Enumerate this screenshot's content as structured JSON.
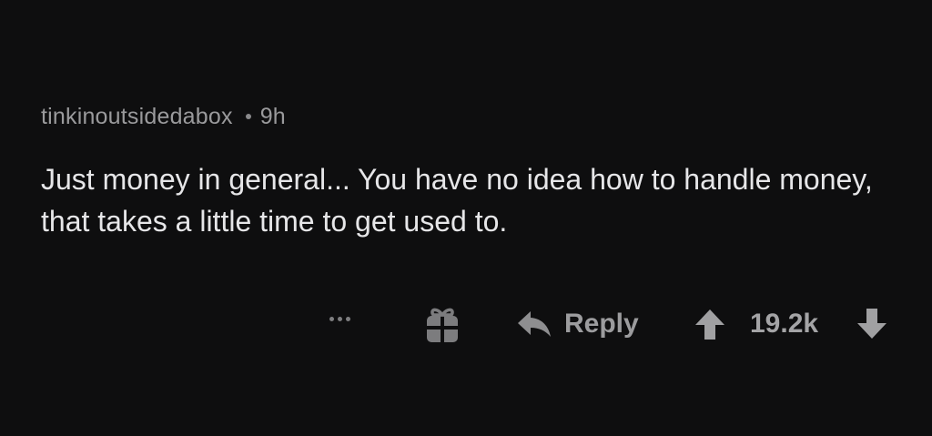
{
  "comment": {
    "author": "tinkinoutsidedabox",
    "age": "9h",
    "body": "Just money in general... You have no idea how to handle money, that takes a little time to get used to."
  },
  "actions": {
    "more_icon": "more-dots-icon",
    "gift_icon": "gift-icon",
    "reply_label": "Reply",
    "reply_icon": "reply-arrow-icon",
    "upvote_icon": "upvote-arrow-icon",
    "score": "19.2k",
    "downvote_icon": "downvote-arrow-icon"
  },
  "colors": {
    "background": "#0e0e0f",
    "author_text": "#9a9a9c",
    "body_text": "#e6e6e8",
    "action_text": "#9c9c9e"
  }
}
